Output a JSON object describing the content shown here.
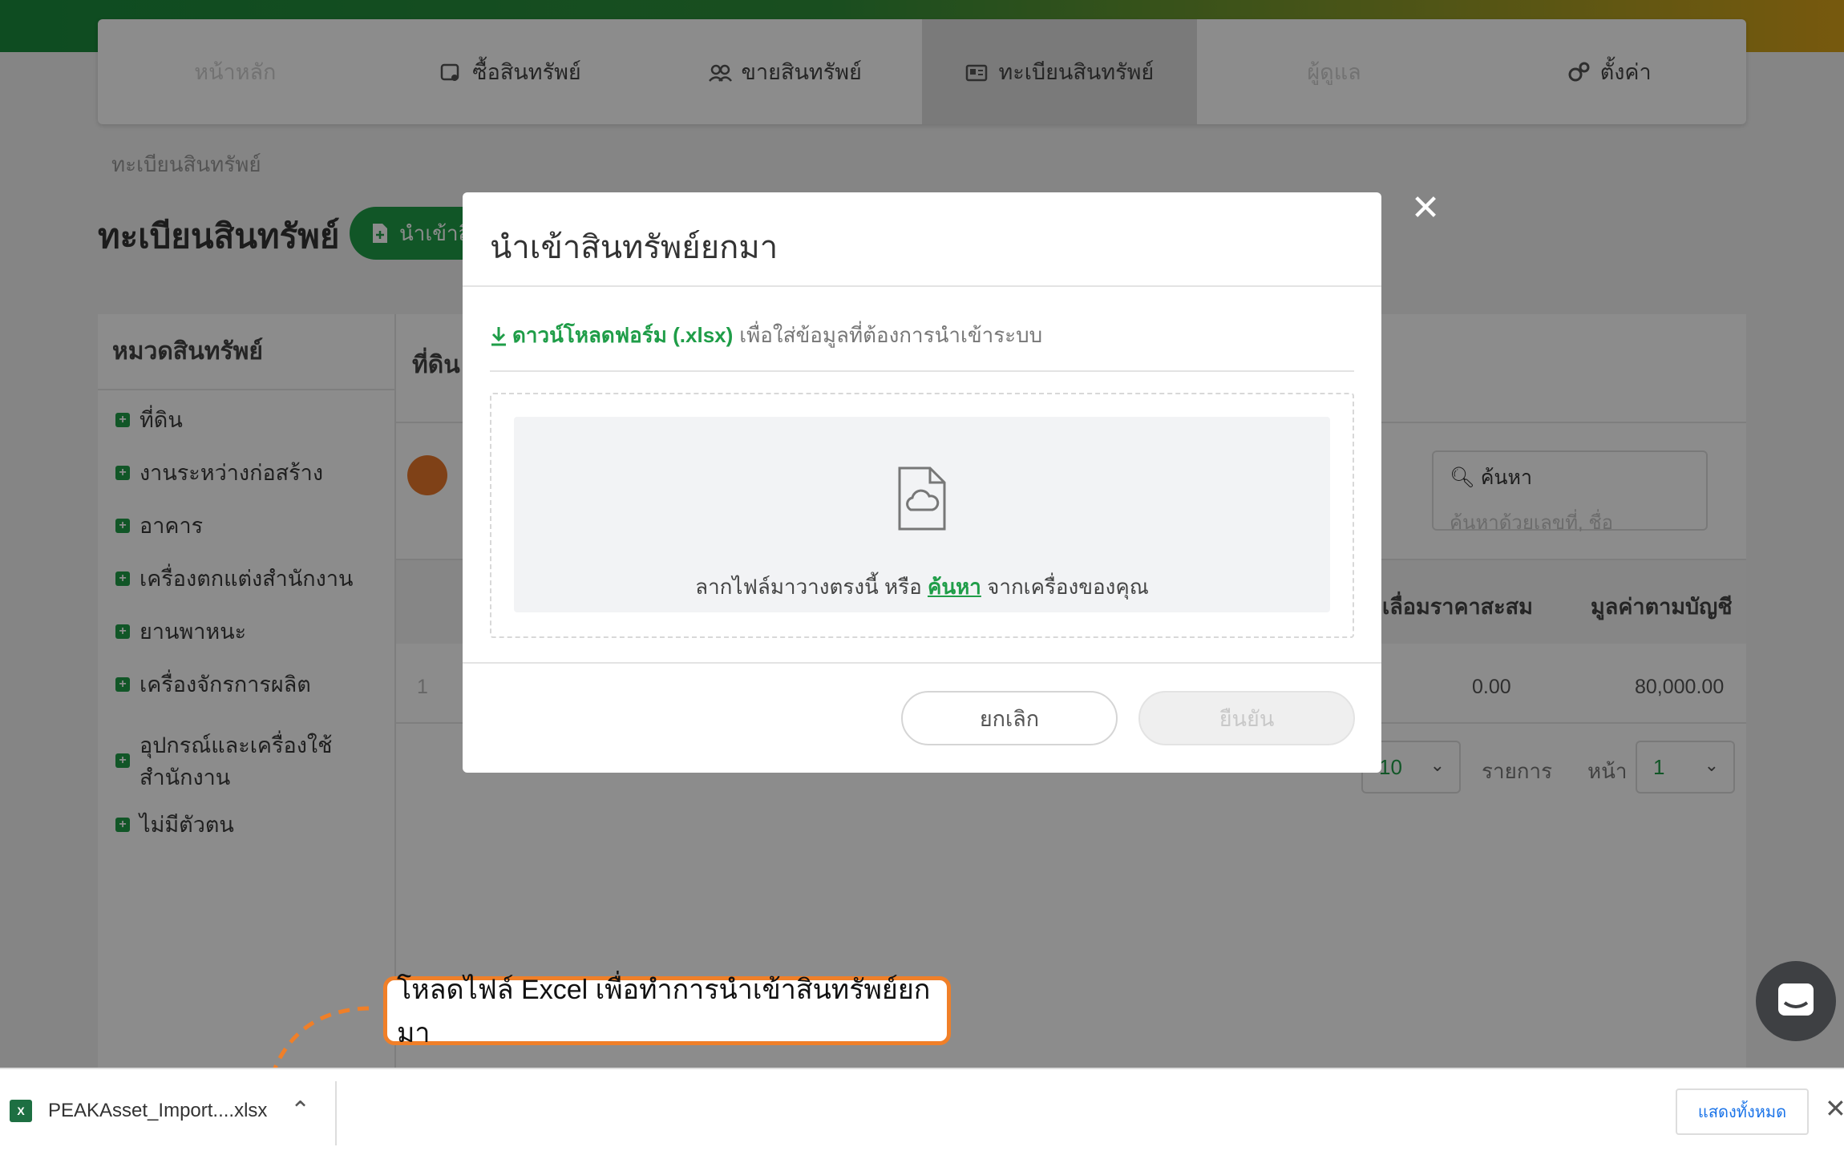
{
  "nav": {
    "items": [
      {
        "label": "หน้าหลัก",
        "icon": "home-icon"
      },
      {
        "label": "ซื้อสินทรัพย์",
        "icon": "cart-icon"
      },
      {
        "label": "ขายสินทรัพย์",
        "icon": "users-icon"
      },
      {
        "label": "ทะเบียนสินทรัพย์",
        "icon": "register-icon"
      },
      {
        "label": "ผู้ดูแล",
        "icon": "admin-icon"
      },
      {
        "label": "ตั้งค่า",
        "icon": "gears-icon"
      }
    ]
  },
  "breadcrumb": "ทะเบียนสินทรัพย์",
  "page": {
    "title": "ทะเบียนสินทรัพย์",
    "import_button": "นำเข้าสิ"
  },
  "sidebar": {
    "heading": "หมวดสินทรัพย์",
    "categories": [
      "ที่ดิน",
      "งานระหว่างก่อสร้าง",
      "อาคาร",
      "เครื่องตกแต่งสำนักงาน",
      "ยานพาหนะ",
      "เครื่องจักรการผลิต",
      "อุปกรณ์และเครื่องใช้",
      "สำนักงาน",
      "ไม่มีตัวตน"
    ]
  },
  "main": {
    "tab": "ที่ดิน",
    "search": {
      "label": "ค้นหา",
      "placeholder": "ค้นหาด้วยเลขที่, ชื่อ"
    },
    "columns": [
      "เลื่อมราคาสะสม",
      "มูลค่าตามบัญชี"
    ],
    "row": {
      "index": "1",
      "accumulated": "0.00",
      "book_value": "80,000.00"
    },
    "pager": {
      "per_page": "10",
      "items_label": "รายการ",
      "page_label": "หน้า",
      "page": "1"
    }
  },
  "modal": {
    "title": "นำเข้าสินทรัพย์ยกมา",
    "download_link": "ดาวน์โหลดฟอร์ม (.xlsx)",
    "download_hint": "เพื่อใส่ข้อมูลที่ต้องการนำเข้าระบบ",
    "drop_text_before": "ลากไฟล์มาวางตรงนี้ หรือ",
    "drop_link": "ค้นหา",
    "drop_text_after": "จากเครื่องของคุณ",
    "cancel": "ยกเลิก",
    "confirm": "ยืนยัน"
  },
  "callout": "โหลดไฟล์ Excel เพื่อทำการนำเข้าสินทรัพย์ยกมา",
  "download_bar": {
    "filename": "PEAKAsset_Import....xlsx",
    "show_all": "แสดงทั้งหมด"
  },
  "colors": {
    "brand_green": "#1f9d48",
    "callout_orange": "#f07f28"
  }
}
